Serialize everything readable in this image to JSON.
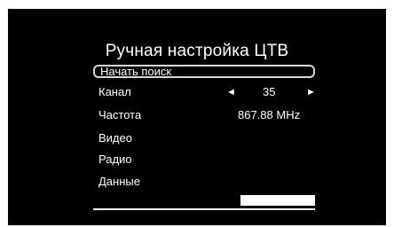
{
  "menu": {
    "title": "Ручная настройка ЦТВ",
    "start_search": "Начать поиск",
    "channel_label": "Канал",
    "channel_value": "35",
    "arrow_left": "◄",
    "arrow_right": "►",
    "frequency_label": "Частота",
    "frequency_value": "867.88 MHz",
    "video_label": "Видео",
    "radio_label": "Радио",
    "data_label": "Данные"
  },
  "colors": {
    "background": "#000000",
    "text": "#ffffff",
    "highlight_border": "#d8d8d8"
  }
}
